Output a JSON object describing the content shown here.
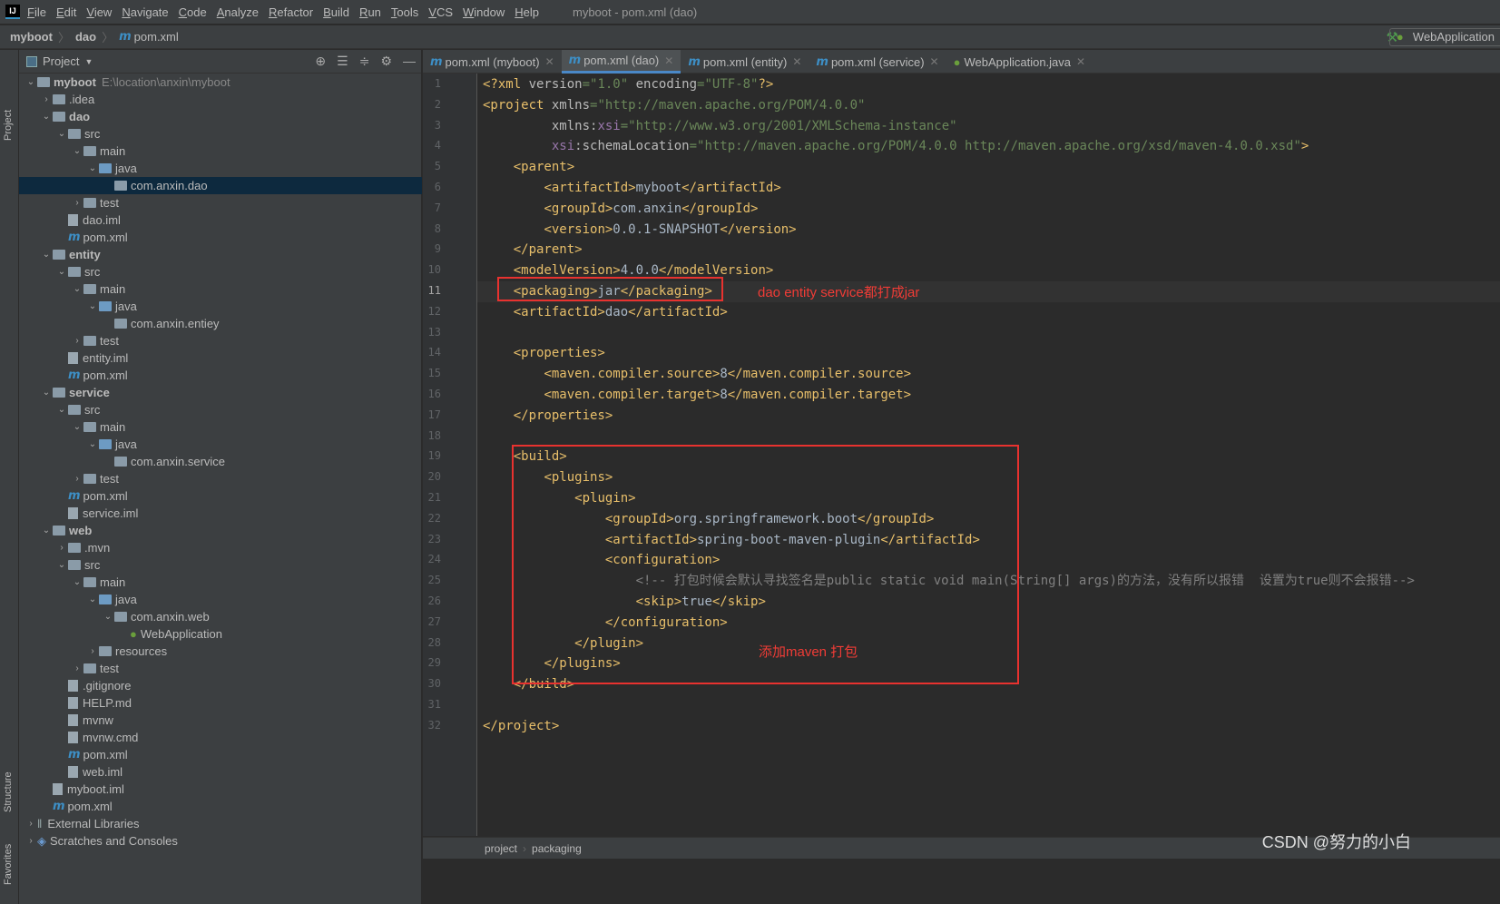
{
  "menubar": {
    "items": [
      "File",
      "Edit",
      "View",
      "Navigate",
      "Code",
      "Analyze",
      "Refactor",
      "Build",
      "Run",
      "Tools",
      "VCS",
      "Window",
      "Help"
    ],
    "window_title": "myboot - pom.xml (dao)"
  },
  "breadcrumb": [
    "myboot",
    "dao",
    "pom.xml"
  ],
  "run_config": "WebApplication",
  "side_tabs": {
    "project": "Project",
    "structure": "Structure",
    "favorites": "Favorites"
  },
  "project_panel": {
    "title": "Project",
    "tree": [
      {
        "l": 0,
        "o": "v",
        "i": "module",
        "t": "myboot",
        "b": true,
        "h": "E:\\location\\anxin\\myboot"
      },
      {
        "l": 1,
        "o": ">",
        "i": "folder",
        "t": ".idea"
      },
      {
        "l": 1,
        "o": "v",
        "i": "module",
        "t": "dao",
        "b": true
      },
      {
        "l": 2,
        "o": "v",
        "i": "folder",
        "t": "src"
      },
      {
        "l": 3,
        "o": "v",
        "i": "folder",
        "t": "main"
      },
      {
        "l": 4,
        "o": "v",
        "i": "src",
        "t": "java"
      },
      {
        "l": 5,
        "o": "",
        "i": "pkg",
        "t": "com.anxin.dao",
        "sel": true
      },
      {
        "l": 3,
        "o": ">",
        "i": "folder",
        "t": "test"
      },
      {
        "l": 2,
        "o": "",
        "i": "file",
        "t": "dao.iml"
      },
      {
        "l": 2,
        "o": "",
        "i": "maven",
        "t": "pom.xml"
      },
      {
        "l": 1,
        "o": "v",
        "i": "module",
        "t": "entity",
        "b": true
      },
      {
        "l": 2,
        "o": "v",
        "i": "folder",
        "t": "src"
      },
      {
        "l": 3,
        "o": "v",
        "i": "folder",
        "t": "main"
      },
      {
        "l": 4,
        "o": "v",
        "i": "src",
        "t": "java"
      },
      {
        "l": 5,
        "o": "",
        "i": "pkg",
        "t": "com.anxin.entiey"
      },
      {
        "l": 3,
        "o": ">",
        "i": "folder",
        "t": "test"
      },
      {
        "l": 2,
        "o": "",
        "i": "file",
        "t": "entity.iml"
      },
      {
        "l": 2,
        "o": "",
        "i": "maven",
        "t": "pom.xml"
      },
      {
        "l": 1,
        "o": "v",
        "i": "module",
        "t": "service",
        "b": true
      },
      {
        "l": 2,
        "o": "v",
        "i": "folder",
        "t": "src"
      },
      {
        "l": 3,
        "o": "v",
        "i": "folder",
        "t": "main"
      },
      {
        "l": 4,
        "o": "v",
        "i": "src",
        "t": "java"
      },
      {
        "l": 5,
        "o": "",
        "i": "pkg",
        "t": "com.anxin.service"
      },
      {
        "l": 3,
        "o": ">",
        "i": "folder",
        "t": "test"
      },
      {
        "l": 2,
        "o": "",
        "i": "maven",
        "t": "pom.xml"
      },
      {
        "l": 2,
        "o": "",
        "i": "file",
        "t": "service.iml"
      },
      {
        "l": 1,
        "o": "v",
        "i": "module",
        "t": "web",
        "b": true
      },
      {
        "l": 2,
        "o": ">",
        "i": "folder",
        "t": ".mvn"
      },
      {
        "l": 2,
        "o": "v",
        "i": "folder",
        "t": "src"
      },
      {
        "l": 3,
        "o": "v",
        "i": "folder",
        "t": "main"
      },
      {
        "l": 4,
        "o": "v",
        "i": "src",
        "t": "java"
      },
      {
        "l": 5,
        "o": "v",
        "i": "pkg",
        "t": "com.anxin.web"
      },
      {
        "l": 6,
        "o": "",
        "i": "spring",
        "t": "WebApplication"
      },
      {
        "l": 4,
        "o": ">",
        "i": "folder",
        "t": "resources"
      },
      {
        "l": 3,
        "o": ">",
        "i": "folder",
        "t": "test"
      },
      {
        "l": 2,
        "o": "",
        "i": "file",
        "t": ".gitignore"
      },
      {
        "l": 2,
        "o": "",
        "i": "file",
        "t": "HELP.md"
      },
      {
        "l": 2,
        "o": "",
        "i": "file",
        "t": "mvnw"
      },
      {
        "l": 2,
        "o": "",
        "i": "file",
        "t": "mvnw.cmd"
      },
      {
        "l": 2,
        "o": "",
        "i": "maven",
        "t": "pom.xml"
      },
      {
        "l": 2,
        "o": "",
        "i": "file",
        "t": "web.iml"
      },
      {
        "l": 1,
        "o": "",
        "i": "file",
        "t": "myboot.iml"
      },
      {
        "l": 1,
        "o": "",
        "i": "maven",
        "t": "pom.xml"
      },
      {
        "l": 0,
        "o": ">",
        "i": "lib",
        "t": "External Libraries"
      },
      {
        "l": 0,
        "o": ">",
        "i": "scratch",
        "t": "Scratches and Consoles"
      }
    ]
  },
  "tabs": [
    {
      "t": "pom.xml (myboot)",
      "i": "maven"
    },
    {
      "t": "pom.xml (dao)",
      "i": "maven",
      "active": true
    },
    {
      "t": "pom.xml (entity)",
      "i": "maven"
    },
    {
      "t": "pom.xml (service)",
      "i": "maven"
    },
    {
      "t": "WebApplication.java",
      "i": "spring"
    }
  ],
  "current_line": 11,
  "code": [
    [
      [
        "t",
        "<?xml "
      ],
      [
        "a",
        "version"
      ],
      [
        "v",
        "=\"1.0\" "
      ],
      [
        "a",
        "encoding"
      ],
      [
        "v",
        "=\"UTF-8\""
      ],
      [
        "t",
        "?>"
      ]
    ],
    [
      [
        "t",
        "<project "
      ],
      [
        "a",
        "xmlns"
      ],
      [
        "v",
        "=\"http://maven.apache.org/POM/4.0.0\""
      ]
    ],
    [
      [
        "",
        "         "
      ],
      [
        "a",
        "xmlns:"
      ],
      [
        "ns",
        "xsi"
      ],
      [
        "v",
        "=\"http://www.w3.org/2001/XMLSchema-instance\""
      ]
    ],
    [
      [
        "",
        "         "
      ],
      [
        "ns",
        "xsi"
      ],
      [
        "a",
        ":schemaLocation"
      ],
      [
        "v",
        "=\"http://maven.apache.org/POM/4.0.0 http://maven.apache.org/xsd/maven-4.0.0.xsd\""
      ],
      [
        "t",
        ">"
      ]
    ],
    [
      [
        "",
        "    "
      ],
      [
        "t",
        "<parent>"
      ]
    ],
    [
      [
        "",
        "        "
      ],
      [
        "t",
        "<artifactId>"
      ],
      [
        "",
        "myboot"
      ],
      [
        "t",
        "</artifactId>"
      ]
    ],
    [
      [
        "",
        "        "
      ],
      [
        "t",
        "<groupId>"
      ],
      [
        "",
        "com.anxin"
      ],
      [
        "t",
        "</groupId>"
      ]
    ],
    [
      [
        "",
        "        "
      ],
      [
        "t",
        "<version>"
      ],
      [
        "",
        "0.0.1-SNAPSHOT"
      ],
      [
        "t",
        "</version>"
      ]
    ],
    [
      [
        "",
        "    "
      ],
      [
        "t",
        "</parent>"
      ]
    ],
    [
      [
        "",
        "    "
      ],
      [
        "t",
        "<modelVersion>"
      ],
      [
        "",
        "4.0.0"
      ],
      [
        "t",
        "</modelVersion>"
      ]
    ],
    [
      [
        "",
        "    "
      ],
      [
        "t",
        "<packaging>"
      ],
      [
        "",
        "jar"
      ],
      [
        "t",
        "</packaging>"
      ]
    ],
    [
      [
        "",
        "    "
      ],
      [
        "t",
        "<artifactId>"
      ],
      [
        "",
        "dao"
      ],
      [
        "t",
        "</artifactId>"
      ]
    ],
    [],
    [
      [
        "",
        "    "
      ],
      [
        "t",
        "<properties>"
      ]
    ],
    [
      [
        "",
        "        "
      ],
      [
        "t",
        "<maven.compiler.source>"
      ],
      [
        "",
        "8"
      ],
      [
        "t",
        "</maven.compiler.source>"
      ]
    ],
    [
      [
        "",
        "        "
      ],
      [
        "t",
        "<maven.compiler.target>"
      ],
      [
        "",
        "8"
      ],
      [
        "t",
        "</maven.compiler.target>"
      ]
    ],
    [
      [
        "",
        "    "
      ],
      [
        "t",
        "</properties>"
      ]
    ],
    [],
    [
      [
        "",
        "    "
      ],
      [
        "t",
        "<build>"
      ]
    ],
    [
      [
        "",
        "        "
      ],
      [
        "t",
        "<plugins>"
      ]
    ],
    [
      [
        "",
        "            "
      ],
      [
        "t",
        "<plugin>"
      ]
    ],
    [
      [
        "",
        "                "
      ],
      [
        "t",
        "<groupId>"
      ],
      [
        "",
        "org.springframework.boot"
      ],
      [
        "t",
        "</groupId>"
      ]
    ],
    [
      [
        "",
        "                "
      ],
      [
        "t",
        "<artifactId>"
      ],
      [
        "",
        "spring-boot-maven-plugin"
      ],
      [
        "t",
        "</artifactId>"
      ]
    ],
    [
      [
        "",
        "                "
      ],
      [
        "t",
        "<configuration>"
      ]
    ],
    [
      [
        "",
        "                    "
      ],
      [
        "c",
        "<!-- 打包时候会默认寻找签名是public static void main(String[] args)的方法，没有所以报错  设置为true则不会报错-->"
      ]
    ],
    [
      [
        "",
        "                    "
      ],
      [
        "t",
        "<skip>"
      ],
      [
        "",
        "true"
      ],
      [
        "t",
        "</skip>"
      ]
    ],
    [
      [
        "",
        "                "
      ],
      [
        "t",
        "</configuration>"
      ]
    ],
    [
      [
        "",
        "            "
      ],
      [
        "t",
        "</plugin>"
      ]
    ],
    [
      [
        "",
        "        "
      ],
      [
        "t",
        "</plugins>"
      ]
    ],
    [
      [
        "",
        "    "
      ],
      [
        "t",
        "</build>"
      ]
    ],
    [],
    [
      [
        "t",
        "</project>"
      ]
    ]
  ],
  "annotations": {
    "packaging_note": "dao entity service都打成jar",
    "build_note": "添加maven 打包"
  },
  "status_breadcrumb": [
    "project",
    "packaging"
  ],
  "watermark": "CSDN @努力的小白"
}
